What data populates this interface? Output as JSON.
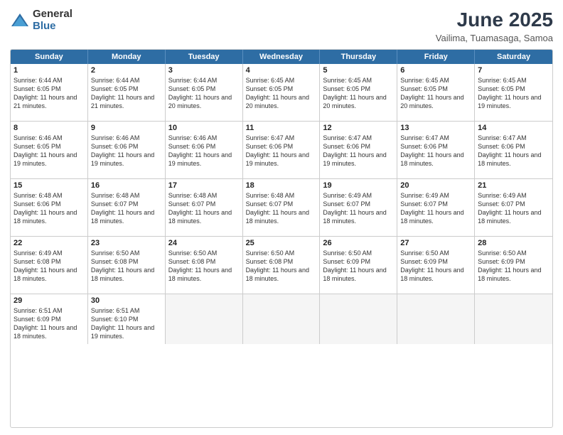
{
  "logo": {
    "general": "General",
    "blue": "Blue"
  },
  "title": "June 2025",
  "location": "Vailima, Tuamasaga, Samoa",
  "days": [
    "Sunday",
    "Monday",
    "Tuesday",
    "Wednesday",
    "Thursday",
    "Friday",
    "Saturday"
  ],
  "rows": [
    [
      {
        "num": "1",
        "rise": "6:44 AM",
        "set": "6:05 PM",
        "daylight": "11 hours and 21 minutes."
      },
      {
        "num": "2",
        "rise": "6:44 AM",
        "set": "6:05 PM",
        "daylight": "11 hours and 21 minutes."
      },
      {
        "num": "3",
        "rise": "6:44 AM",
        "set": "6:05 PM",
        "daylight": "11 hours and 20 minutes."
      },
      {
        "num": "4",
        "rise": "6:45 AM",
        "set": "6:05 PM",
        "daylight": "11 hours and 20 minutes."
      },
      {
        "num": "5",
        "rise": "6:45 AM",
        "set": "6:05 PM",
        "daylight": "11 hours and 20 minutes."
      },
      {
        "num": "6",
        "rise": "6:45 AM",
        "set": "6:05 PM",
        "daylight": "11 hours and 20 minutes."
      },
      {
        "num": "7",
        "rise": "6:45 AM",
        "set": "6:05 PM",
        "daylight": "11 hours and 19 minutes."
      }
    ],
    [
      {
        "num": "8",
        "rise": "6:46 AM",
        "set": "6:05 PM",
        "daylight": "11 hours and 19 minutes."
      },
      {
        "num": "9",
        "rise": "6:46 AM",
        "set": "6:06 PM",
        "daylight": "11 hours and 19 minutes."
      },
      {
        "num": "10",
        "rise": "6:46 AM",
        "set": "6:06 PM",
        "daylight": "11 hours and 19 minutes."
      },
      {
        "num": "11",
        "rise": "6:47 AM",
        "set": "6:06 PM",
        "daylight": "11 hours and 19 minutes."
      },
      {
        "num": "12",
        "rise": "6:47 AM",
        "set": "6:06 PM",
        "daylight": "11 hours and 19 minutes."
      },
      {
        "num": "13",
        "rise": "6:47 AM",
        "set": "6:06 PM",
        "daylight": "11 hours and 18 minutes."
      },
      {
        "num": "14",
        "rise": "6:47 AM",
        "set": "6:06 PM",
        "daylight": "11 hours and 18 minutes."
      }
    ],
    [
      {
        "num": "15",
        "rise": "6:48 AM",
        "set": "6:06 PM",
        "daylight": "11 hours and 18 minutes."
      },
      {
        "num": "16",
        "rise": "6:48 AM",
        "set": "6:07 PM",
        "daylight": "11 hours and 18 minutes."
      },
      {
        "num": "17",
        "rise": "6:48 AM",
        "set": "6:07 PM",
        "daylight": "11 hours and 18 minutes."
      },
      {
        "num": "18",
        "rise": "6:48 AM",
        "set": "6:07 PM",
        "daylight": "11 hours and 18 minutes."
      },
      {
        "num": "19",
        "rise": "6:49 AM",
        "set": "6:07 PM",
        "daylight": "11 hours and 18 minutes."
      },
      {
        "num": "20",
        "rise": "6:49 AM",
        "set": "6:07 PM",
        "daylight": "11 hours and 18 minutes."
      },
      {
        "num": "21",
        "rise": "6:49 AM",
        "set": "6:07 PM",
        "daylight": "11 hours and 18 minutes."
      }
    ],
    [
      {
        "num": "22",
        "rise": "6:49 AM",
        "set": "6:08 PM",
        "daylight": "11 hours and 18 minutes."
      },
      {
        "num": "23",
        "rise": "6:50 AM",
        "set": "6:08 PM",
        "daylight": "11 hours and 18 minutes."
      },
      {
        "num": "24",
        "rise": "6:50 AM",
        "set": "6:08 PM",
        "daylight": "11 hours and 18 minutes."
      },
      {
        "num": "25",
        "rise": "6:50 AM",
        "set": "6:08 PM",
        "daylight": "11 hours and 18 minutes."
      },
      {
        "num": "26",
        "rise": "6:50 AM",
        "set": "6:09 PM",
        "daylight": "11 hours and 18 minutes."
      },
      {
        "num": "27",
        "rise": "6:50 AM",
        "set": "6:09 PM",
        "daylight": "11 hours and 18 minutes."
      },
      {
        "num": "28",
        "rise": "6:50 AM",
        "set": "6:09 PM",
        "daylight": "11 hours and 18 minutes."
      }
    ],
    [
      {
        "num": "29",
        "rise": "6:51 AM",
        "set": "6:09 PM",
        "daylight": "11 hours and 18 minutes."
      },
      {
        "num": "30",
        "rise": "6:51 AM",
        "set": "6:10 PM",
        "daylight": "11 hours and 19 minutes."
      },
      null,
      null,
      null,
      null,
      null
    ]
  ]
}
